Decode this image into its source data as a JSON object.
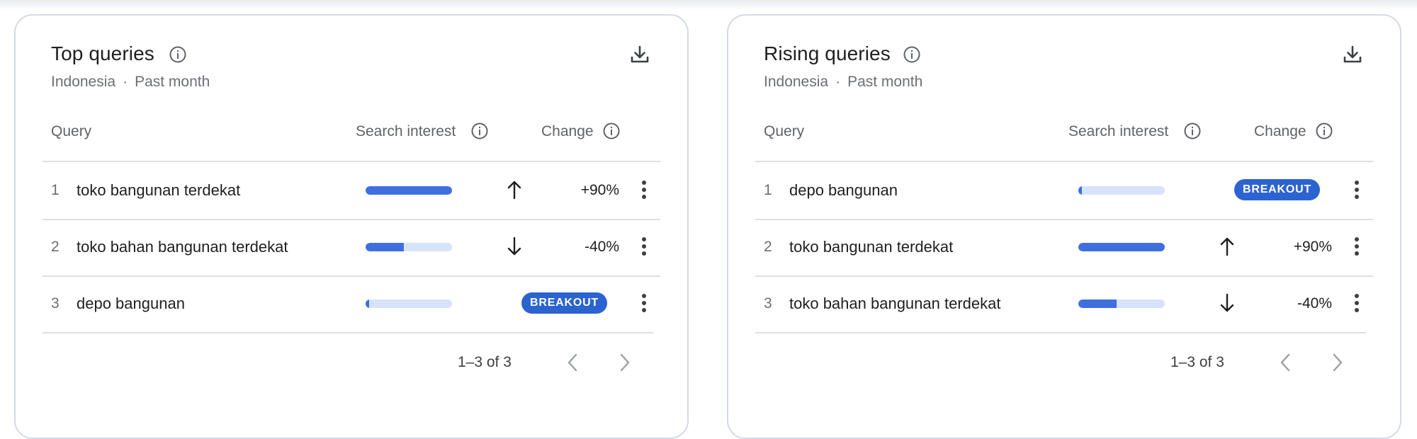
{
  "panels": [
    {
      "title": "Top queries",
      "subtitle_region": "Indonesia",
      "subtitle_separator": "·",
      "subtitle_period": "Past month",
      "columns": {
        "query": "Query",
        "search_interest": "Search interest",
        "change": "Change"
      },
      "rows": [
        {
          "rank": "1",
          "query": "toko bangunan terdekat",
          "interest": 1.0,
          "change": "+90%",
          "direction": "up"
        },
        {
          "rank": "2",
          "query": "toko bahan bangunan terdekat",
          "interest": 0.44,
          "change": "-40%",
          "direction": "down"
        },
        {
          "rank": "3",
          "query": "depo bangunan",
          "interest": 0.04,
          "change": "BREAKOUT",
          "direction": "breakout"
        }
      ],
      "pagination": "1–3 of 3"
    },
    {
      "title": "Rising queries",
      "subtitle_region": "Indonesia",
      "subtitle_separator": "·",
      "subtitle_period": "Past month",
      "columns": {
        "query": "Query",
        "search_interest": "Search interest",
        "change": "Change"
      },
      "rows": [
        {
          "rank": "1",
          "query": "depo bangunan",
          "interest": 0.04,
          "change": "BREAKOUT",
          "direction": "breakout"
        },
        {
          "rank": "2",
          "query": "toko bangunan terdekat",
          "interest": 1.0,
          "change": "+90%",
          "direction": "up"
        },
        {
          "rank": "3",
          "query": "toko bahan bangunan terdekat",
          "interest": 0.44,
          "change": "-40%",
          "direction": "down"
        }
      ],
      "pagination": "1–3 of 3"
    }
  ],
  "colors": {
    "bar_fill": "#3f6fdf",
    "bar_track": "#d7e3fb",
    "badge": "#2b63d1"
  },
  "icons": {
    "info": "info-icon",
    "download": "download-icon",
    "more": "more-vert-icon",
    "up": "arrow-up-icon",
    "down": "arrow-down-icon",
    "prev": "chevron-left-icon",
    "next": "chevron-right-icon"
  }
}
